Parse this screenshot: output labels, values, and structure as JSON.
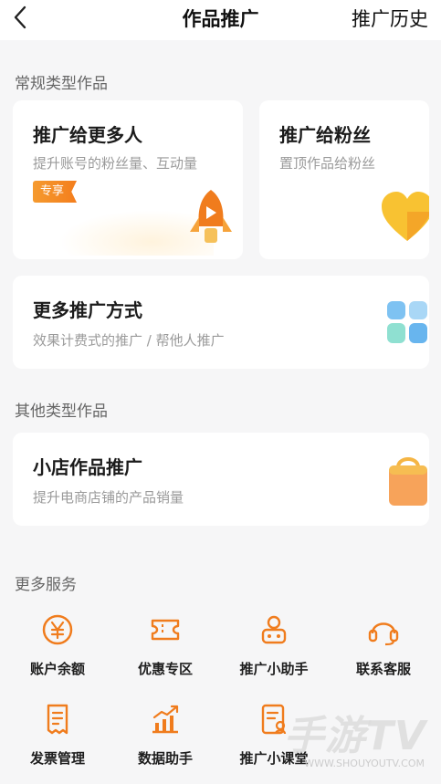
{
  "header": {
    "title": "作品推广",
    "history_label": "推广历史"
  },
  "sections": {
    "regular": "常规类型作品",
    "other": "其他类型作品",
    "more": "更多服务"
  },
  "cards": {
    "more_people": {
      "title": "推广给更多人",
      "subtitle": "提升账号的粉丝量、互动量",
      "badge": "专享"
    },
    "fans": {
      "title": "推广给粉丝",
      "subtitle": "置顶作品给粉丝"
    },
    "more_ways": {
      "title": "更多推广方式",
      "subtitle": "效果计费式的推广 / 帮他人推广"
    },
    "shop": {
      "title": "小店作品推广",
      "subtitle": "提升电商店铺的产品销量"
    }
  },
  "services": [
    {
      "label": "账户余额",
      "icon": "yen-coin-icon"
    },
    {
      "label": "优惠专区",
      "icon": "coupon-icon"
    },
    {
      "label": "推广小助手",
      "icon": "assistant-icon"
    },
    {
      "label": "联系客服",
      "icon": "headset-icon"
    },
    {
      "label": "发票管理",
      "icon": "invoice-icon"
    },
    {
      "label": "数据助手",
      "icon": "data-chart-icon"
    },
    {
      "label": "推广小课堂",
      "icon": "classroom-icon"
    }
  ],
  "watermark": {
    "main": "手游TV",
    "url": "WWW.SHOUYOUTV.COM"
  },
  "colors": {
    "accent": "#f07c1d",
    "accent_light": "#f6a33a"
  }
}
